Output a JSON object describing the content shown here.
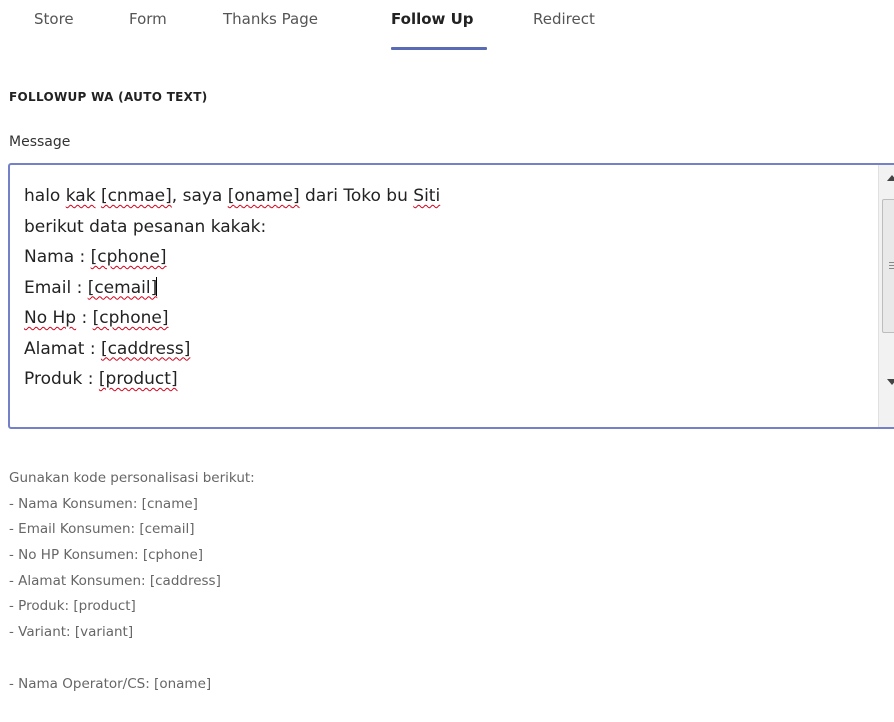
{
  "tabs": [
    {
      "label": "Store",
      "active": false
    },
    {
      "label": "Form",
      "active": false
    },
    {
      "label": "Thanks Page",
      "active": false
    },
    {
      "label": "Follow Up",
      "active": true
    },
    {
      "label": "Redirect",
      "active": false
    }
  ],
  "accent_color": "#5a6bb5",
  "section_title": "FOLLOWUP WA (AUTO TEXT)",
  "message_field": {
    "label": "Message",
    "lines": [
      [
        "halo ",
        "kak",
        " ",
        "[cnmae]",
        ", saya ",
        "[oname]",
        " dari Toko bu ",
        "Siti"
      ],
      [
        "berikut data pesanan kakak:"
      ],
      [
        "Nama : ",
        "[cphone]"
      ],
      [
        "Email : ",
        "[cemail]"
      ],
      [
        "No Hp",
        " : ",
        "[cphone]"
      ],
      [
        "Alamat : ",
        "[caddress]"
      ],
      [
        "Produk : ",
        "[product]"
      ]
    ]
  },
  "help": {
    "intro": "Gunakan kode personalisasi berikut:",
    "codes": [
      "- Nama Konsumen: [cname]",
      "- Email Konsumen: [cemail]",
      "- No HP Konsumen: [cphone]",
      "- Alamat Konsumen: [caddress]",
      "- Produk: [product]",
      "- Variant: [variant]"
    ],
    "operator": "- Nama Operator/CS: [oname]"
  }
}
